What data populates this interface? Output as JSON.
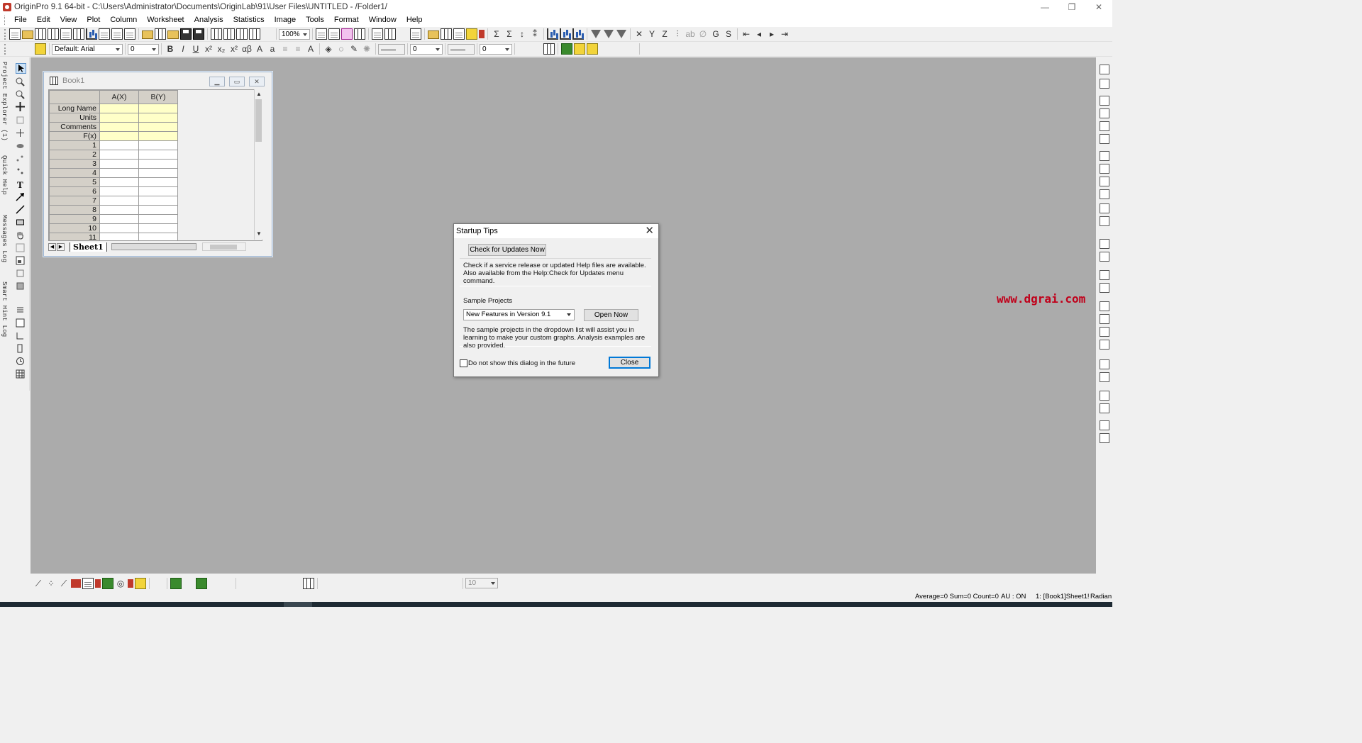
{
  "window": {
    "title": "OriginPro 9.1 64-bit - C:\\Users\\Administrator\\Documents\\OriginLab\\91\\User Files\\UNTITLED - /Folder1/",
    "minimize": "—",
    "restore": "❐",
    "close": "✕"
  },
  "menu": [
    "File",
    "Edit",
    "View",
    "Plot",
    "Column",
    "Worksheet",
    "Analysis",
    "Statistics",
    "Image",
    "Tools",
    "Format",
    "Window",
    "Help"
  ],
  "toolbar1": {
    "zoom": "100%"
  },
  "toolbar2": {
    "font": "Default: Arial",
    "font_size": "0",
    "bold": "B",
    "italic": "I",
    "underline": "U",
    "greek": "αβ",
    "line_width": "0",
    "line_width2": "0"
  },
  "left_tabs": [
    "Project Explorer (1)",
    "Quick Help",
    "Messages Log",
    "Smart Hint Log"
  ],
  "book": {
    "title": "Book1",
    "columns": [
      "A(X)",
      "B(Y)"
    ],
    "meta_rows": [
      "Long Name",
      "Units",
      "Comments",
      "F(x)"
    ],
    "rows": [
      "1",
      "2",
      "3",
      "4",
      "5",
      "6",
      "7",
      "8",
      "9",
      "10",
      "11"
    ],
    "sheet_tab": "Sheet1"
  },
  "dialog": {
    "title": "Startup Tips",
    "check_updates_button": "Check for Updates Now",
    "check_updates_text": "Check if a service release or updated Help files are available. Also available from the Help:Check for Updates menu command.",
    "sample_label": "Sample Projects",
    "sample_selected": "New Features in Version 9.1",
    "open_now_button": "Open Now",
    "sample_text": "The sample projects in the dropdown list will assist you in learning to make your custom graphs. Analysis examples are also provided.",
    "dont_show_label": "Do not show this dialog in the future",
    "close_button": "Close"
  },
  "watermark": "www.dgrai.com",
  "bottom_toolbar": {
    "size": "10"
  },
  "status": {
    "stats": "Average=0 Sum=0 Count=0",
    "au": "AU : ON",
    "active": "1: [Book1]Sheet1!",
    "angle": "Radian"
  },
  "colors": {
    "workspace": "#ababab",
    "meta_cell": "#ffffc8",
    "header_cell": "#d4d0c8",
    "watermark": "#c0001a"
  }
}
